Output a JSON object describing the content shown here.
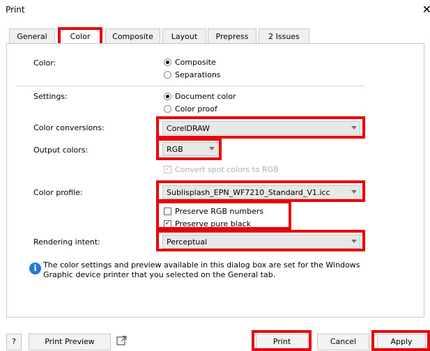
{
  "window": {
    "title": "Print",
    "close_glyph": "✕"
  },
  "tabs": [
    "General",
    "Color",
    "Composite",
    "Layout",
    "Prepress",
    "2 Issues"
  ],
  "color": {
    "label": "Color:",
    "options": [
      "Composite",
      "Separations"
    ],
    "selected": "Composite"
  },
  "settings": {
    "label": "Settings:",
    "options": [
      "Document color",
      "Color proof"
    ],
    "selected": "Document color"
  },
  "color_conversions": {
    "label": "Color conversions:",
    "value": "CorelDRAW"
  },
  "output_colors": {
    "label": "Output colors:",
    "value": "RGB"
  },
  "convert_spot": {
    "label": "Convert spot colors to RGB",
    "checked": true,
    "enabled": false
  },
  "color_profile": {
    "label": "Color profile:",
    "value": "Sublisplash_EPN_WF7210_Standard_V1.icc"
  },
  "preserve_rgb": {
    "label": "Preserve RGB numbers",
    "checked": false
  },
  "preserve_black": {
    "label": "Preserve pure black",
    "checked": true
  },
  "rendering_intent": {
    "label": "Rendering intent:",
    "value": "Perceptual"
  },
  "info": {
    "line1": "The color settings and preview available in this dialog box are set for the Windows",
    "line2": "Graphic device printer that you selected on the General tab."
  },
  "footer": {
    "help": "?",
    "print_preview": "Print Preview",
    "print": "Print",
    "cancel": "Cancel",
    "apply": "Apply"
  },
  "highlight_color": "#e8000b"
}
